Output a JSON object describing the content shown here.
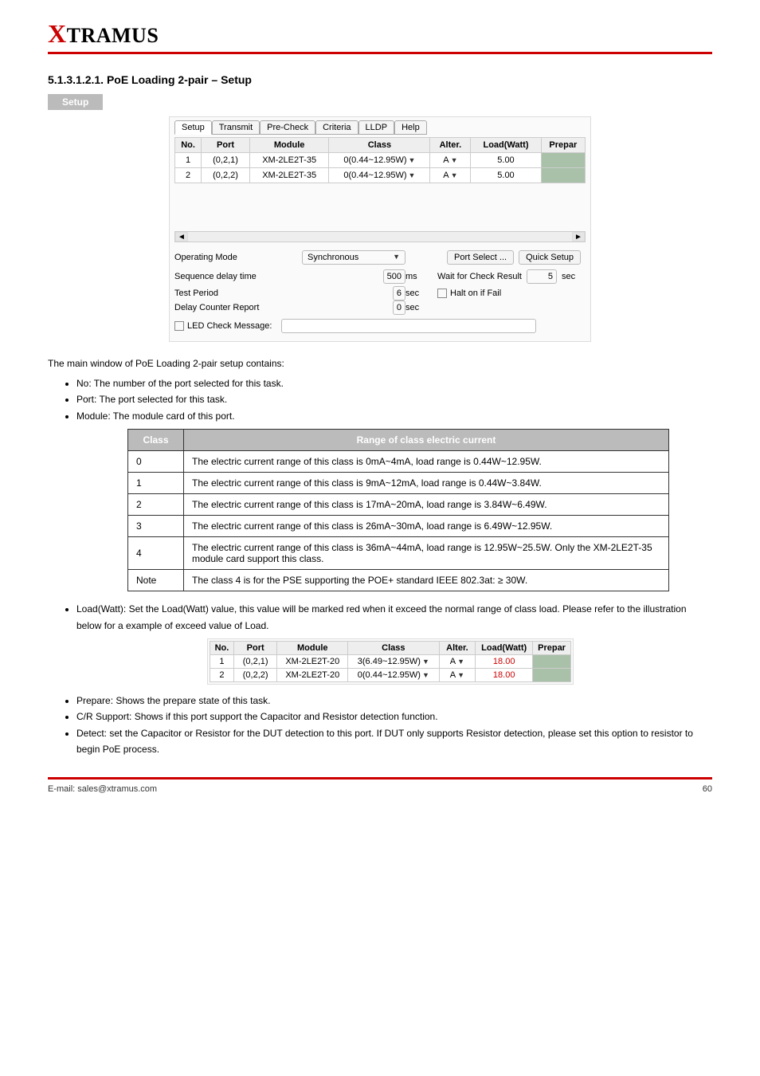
{
  "brand": {
    "prefix": "X",
    "rest": "TRAMUS"
  },
  "section_title": "5.1.3.1.2.1. PoE Loading 2-pair – Setup",
  "setup_label": "Setup",
  "screenshot1": {
    "tabs": [
      "Setup",
      "Transmit",
      "Pre-Check",
      "Criteria",
      "LLDP",
      "Help"
    ],
    "headers": [
      "No.",
      "Port",
      "Module",
      "Class",
      "Alter.",
      "Load(Watt)",
      "Prepar"
    ],
    "rows": [
      {
        "no": "1",
        "port": "(0,2,1)",
        "module": "XM-2LE2T-35",
        "klass": "0(0.44~12.95W)",
        "alter": "A",
        "load": "5.00"
      },
      {
        "no": "2",
        "port": "(0,2,2)",
        "module": "XM-2LE2T-35",
        "klass": "0(0.44~12.95W)",
        "alter": "A",
        "load": "5.00"
      }
    ],
    "op_mode_lbl": "Operating Mode",
    "op_mode_val": "Synchronous",
    "port_select_btn": "Port Select ...",
    "quick_setup_btn": "Quick Setup",
    "seq_delay_lbl": "Sequence delay time",
    "seq_delay_val": "500",
    "seq_delay_unit": "ms",
    "wait_lbl": "Wait for Check Result",
    "wait_val": "5",
    "wait_unit": "sec",
    "test_period_lbl": "Test Period",
    "test_period_val": "6",
    "test_period_unit": "sec",
    "halt_lbl": "Halt on if Fail",
    "delay_counter_lbl": "Delay Counter Report",
    "delay_counter_val": "0",
    "delay_counter_unit": "sec",
    "led_check_lbl": "LED Check  Message:"
  },
  "intro": "The main window of PoE Loading 2-pair setup contains:",
  "b1": {
    "no": "No: The number of the port selected for this task.",
    "port": "Port: The port selected for this task.",
    "module": "Module: The module card of this port."
  },
  "class_table": {
    "headers": [
      "Class",
      "Range of class electric current"
    ],
    "rows": [
      {
        "a": "0",
        "b": "The electric current range of this class is 0mA~4mA, load range is 0.44W~12.95W."
      },
      {
        "a": "1",
        "b": "The electric current range of this class is 9mA~12mA, load range is 0.44W~3.84W."
      },
      {
        "a": "2",
        "b": "The electric current range of this class is 17mA~20mA, load range is 3.84W~6.49W."
      },
      {
        "a": "3",
        "b": "The electric current range of this class is 26mA~30mA, load range is 6.49W~12.95W."
      },
      {
        "a": "4",
        "b": "The electric current range of this class is 36mA~44mA, load range is 12.95W~25.5W. Only the XM-2LE2T-35 module card support this class."
      },
      {
        "a": "Note",
        "b": "The class 4 is for the PSE supporting the POE+ standard IEEE 802.3at: ≥ 30W."
      }
    ]
  },
  "load_bullet": "Load(Watt): Set the Load(Watt) value, this value will be marked red when it exceed the normal range of class load. Please refer to the illustration below for a example of exceed value of Load.",
  "screenshot2": {
    "headers": [
      "No.",
      "Port",
      "Module",
      "Class",
      "Alter.",
      "Load(Watt)",
      "Prepar"
    ],
    "rows": [
      {
        "no": "1",
        "port": "(0,2,1)",
        "module": "XM-2LE2T-20",
        "klass": "3(6.49~12.95W)",
        "alter": "A",
        "load": "18.00"
      },
      {
        "no": "2",
        "port": "(0,2,2)",
        "module": "XM-2LE2T-20",
        "klass": "0(0.44~12.95W)",
        "alter": "A",
        "load": "18.00"
      }
    ]
  },
  "b2": {
    "prepare": "Prepare: Shows the prepare state of this task.",
    "cr": "C/R Support: Shows if this port support the Capacitor and Resistor detection function.",
    "detect": "Detect: set the Capacitor or Resistor for the DUT detection to this port. If DUT only supports Resistor detection, please set this option to resistor to begin PoE process."
  },
  "footer": {
    "left": "E-mail: sales@xtramus.com",
    "right": "60"
  }
}
